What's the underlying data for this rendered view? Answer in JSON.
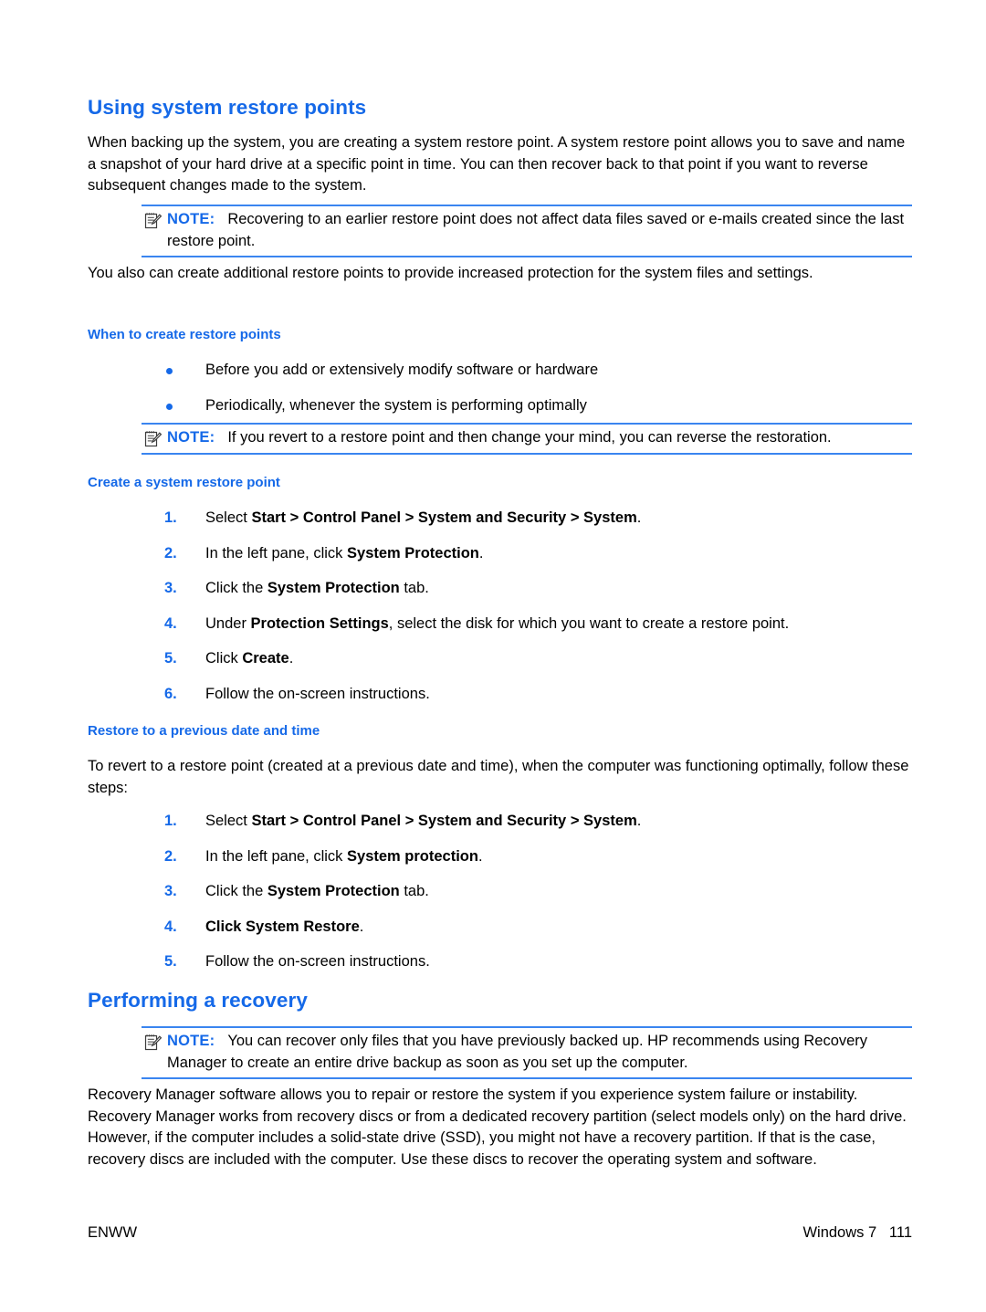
{
  "page": {
    "title": "Using system restore points",
    "accent_color": "#1569e8",
    "note_rule_color": "#3a85f0",
    "background": "#ffffff"
  },
  "headings": {
    "main": "Using system restore points",
    "when_to_create": "When to create restore points",
    "create_point": "Create a system restore point",
    "restore_previous": "Restore to a previous date and time",
    "performing_recovery": "Performing a recovery"
  },
  "paragraphs": {
    "intro": "When backing up the system, you are creating a system restore point. A system restore point allows you to save and name a snapshot of your hard drive at a specific point in time. You can then recover back to that point if you want to reverse subsequent changes made to the system.",
    "additional": "You also can create additional restore points to provide increased protection for the system files and settings.",
    "revert_intro": "To revert to a restore point (created at a previous date and time), when the computer was functioning optimally, follow these steps:",
    "recovery_manager": "Recovery Manager software allows you to repair or restore the system if you experience system failure or instability. Recovery Manager works from recovery discs or from a dedicated recovery partition (select models only) on the hard drive. However, if the computer includes a solid-state drive (SSD), you might not have a recovery partition. If that is the case, recovery discs are included with the computer. Use these discs to recover the operating system and software."
  },
  "notes": {
    "label": "NOTE:",
    "icon": "note-document-pencil-icon",
    "note1": "Recovering to an earlier restore point does not affect data files saved or e-mails created since the last restore point.",
    "note2": "If you revert to a restore point and then change your mind, you can reverse the restoration.",
    "note3": "You can recover only files that you have previously backed up. HP recommends using Recovery Manager to create an entire drive backup as soon as you set up the computer."
  },
  "bullets": [
    "Before you add or extensively modify software or hardware",
    "Periodically, whenever the system is performing optimally"
  ],
  "create_steps": [
    {
      "num": "1.",
      "parts": [
        {
          "t": "Select ",
          "b": false
        },
        {
          "t": "Start > Control Panel > System and Security > System",
          "b": true
        },
        {
          "t": ".",
          "b": false
        }
      ]
    },
    {
      "num": "2.",
      "parts": [
        {
          "t": "In the left pane, click ",
          "b": false
        },
        {
          "t": "System Protection",
          "b": true
        },
        {
          "t": ".",
          "b": false
        }
      ]
    },
    {
      "num": "3.",
      "parts": [
        {
          "t": "Click the ",
          "b": false
        },
        {
          "t": "System Protection",
          "b": true
        },
        {
          "t": " tab.",
          "b": false
        }
      ]
    },
    {
      "num": "4.",
      "parts": [
        {
          "t": "Under ",
          "b": false
        },
        {
          "t": "Protection Settings",
          "b": true
        },
        {
          "t": ", select the disk for which you want to create a restore point.",
          "b": false
        }
      ]
    },
    {
      "num": "5.",
      "parts": [
        {
          "t": "Click ",
          "b": false
        },
        {
          "t": "Create",
          "b": true
        },
        {
          "t": ".",
          "b": false
        }
      ]
    },
    {
      "num": "6.",
      "parts": [
        {
          "t": "Follow the on-screen instructions.",
          "b": false
        }
      ]
    }
  ],
  "restore_steps": [
    {
      "num": "1.",
      "parts": [
        {
          "t": "Select ",
          "b": false
        },
        {
          "t": "Start > Control Panel > System and Security > System",
          "b": true
        },
        {
          "t": ".",
          "b": false
        }
      ]
    },
    {
      "num": "2.",
      "parts": [
        {
          "t": "In the left pane, click ",
          "b": false
        },
        {
          "t": "System protection",
          "b": true
        },
        {
          "t": ".",
          "b": false
        }
      ]
    },
    {
      "num": "3.",
      "parts": [
        {
          "t": "Click the ",
          "b": false
        },
        {
          "t": "System Protection",
          "b": true
        },
        {
          "t": " tab.",
          "b": false
        }
      ]
    },
    {
      "num": "4.",
      "parts": [
        {
          "t": "Click ",
          "b": true
        },
        {
          "t": "System Restore",
          "b": true
        },
        {
          "t": ".",
          "b": false
        }
      ]
    },
    {
      "num": "5.",
      "parts": [
        {
          "t": "Follow the on-screen instructions.",
          "b": false
        }
      ]
    }
  ],
  "footer": {
    "left": "ENWW",
    "right": "Windows 7   111"
  }
}
